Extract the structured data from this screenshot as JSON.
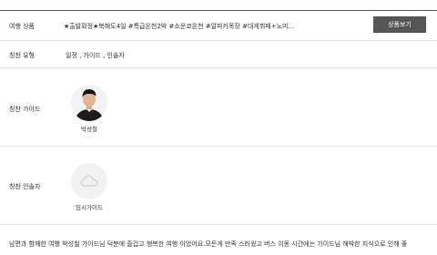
{
  "product": {
    "label": "여행 상품",
    "title": "★출발확정★북해도4일 #특급온천2박 #소운쿄온천 #알파카목장 #대게뷔페+노미...",
    "button_label": "상품보기"
  },
  "praise_type": {
    "label": "칭찬 유형",
    "value": "일정 , 가이드 , 인솔자"
  },
  "praise_guide": {
    "label": "칭찬 가이드",
    "name": "박성철"
  },
  "praise_escort": {
    "label": "칭찬 인솔자",
    "name": "임시가이드"
  },
  "review": {
    "text": "남편과 함께한 여행 박성철 가이드님 덕분에 즐겁고 행복한 여행 이었어요.모든게 만족 스러웠고 버스 이동 시간에는 가이드님 해박한 지식으로 인해 좋"
  }
}
